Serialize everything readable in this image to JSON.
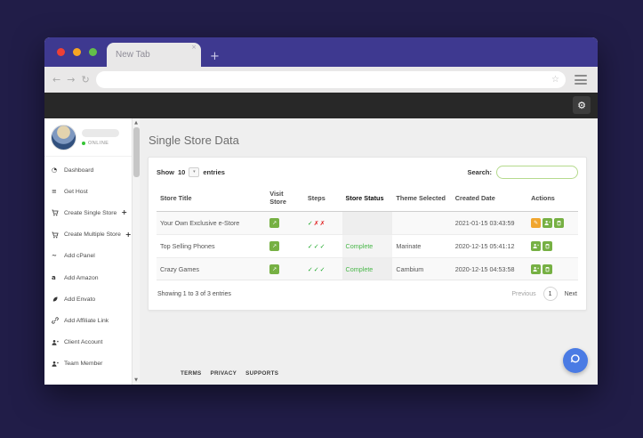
{
  "browser": {
    "tab_title": "New Tab",
    "tab_close_icon": "×",
    "new_tab_icon": "+",
    "back_icon": "←",
    "forward_icon": "→",
    "reload_icon": "↻",
    "bookmark_star_icon": "☆"
  },
  "app_header": {
    "gear_icon": "⚙"
  },
  "sidebar": {
    "online_status": "ONLINE",
    "items": [
      {
        "icon": "dashboard-icon",
        "glyph": "◔",
        "label": "Dashboard",
        "plus": ""
      },
      {
        "icon": "get-host-icon",
        "glyph": "≡",
        "label": "Get Host",
        "plus": ""
      },
      {
        "icon": "cart-icon",
        "glyph": "",
        "label": "Create Single Store",
        "plus": "+"
      },
      {
        "icon": "cart-icon",
        "glyph": "",
        "label": "Create Multiple Store",
        "plus": "+"
      },
      {
        "icon": "cpanel-icon",
        "glyph": "~",
        "label": "Add cPanel",
        "plus": ""
      },
      {
        "icon": "amazon-icon",
        "glyph": "a",
        "label": "Add Amazon",
        "plus": ""
      },
      {
        "icon": "envato-leaf-icon",
        "glyph": "",
        "label": "Add Envato",
        "plus": ""
      },
      {
        "icon": "link-icon",
        "glyph": "",
        "label": "Add Affiliate Link",
        "plus": ""
      },
      {
        "icon": "user-plus-icon",
        "glyph": "",
        "label": "Client Account",
        "plus": ""
      },
      {
        "icon": "user-plus-icon",
        "glyph": "",
        "label": "Team Member",
        "plus": ""
      }
    ]
  },
  "page": {
    "title": "Single Store Data",
    "show_label": "Show",
    "show_value": "10",
    "entries_label": "entries",
    "search_label": "Search:",
    "footer_links": [
      "TERMS",
      "PRIVACY",
      "SUPPORTS"
    ]
  },
  "table": {
    "columns": [
      "Store Title",
      "Visit Store",
      "Steps",
      "Store Status",
      "Theme Selected",
      "Created Date",
      "Actions"
    ],
    "rows": [
      {
        "title": "Your Own Exclusive e-Store",
        "status": "",
        "theme": "",
        "created": "2021-01-15 03:43:59"
      },
      {
        "title": "Top Selling Phones",
        "status": "Complete",
        "theme": "Marinate",
        "created": "2020-12-15 05:41:12"
      },
      {
        "title": "Crazy Games",
        "status": "Complete",
        "theme": "Cambium",
        "created": "2020-12-15 04:53:58"
      }
    ],
    "summary": "Showing 1 to 3 of 3 entries",
    "pagination": {
      "previous": "Previous",
      "page": "1",
      "next": "Next"
    }
  },
  "icons": {
    "check": "✓",
    "cross": "✗",
    "edit": "✎",
    "visit": "↗"
  },
  "theme": {
    "outer_bg": "#211d48",
    "tab_bar_purple": "#3e3990",
    "header_dark": "#282828",
    "accent_green": "#76b043",
    "accent_orange": "#f0a62f",
    "chat_blue": "#4a7be4",
    "check_green": "#1ea82a",
    "cross_red": "#e01f1f",
    "complete_green": "#49b749"
  }
}
